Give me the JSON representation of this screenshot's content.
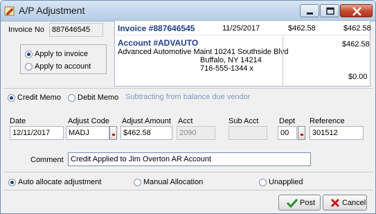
{
  "window": {
    "title": "A/P Adjustment"
  },
  "invoice_header": {
    "invoice_no_label": "Invoice No",
    "invoice_no_value": "887646545",
    "invoice_heading": "Invoice #887646545",
    "date": "11/25/2017",
    "amount_1": "$462.58",
    "amount_2": "$462.58"
  },
  "apply_options": {
    "apply_to_invoice": "Apply to invoice",
    "apply_to_account": "Apply to account",
    "selected": "apply_to_invoice"
  },
  "account": {
    "heading": "Account #ADVAUTO",
    "name_line": "Advanced Automotive Maint 10241 Southside Blvd",
    "city_line": "Buffalo, NY  14214",
    "phone_line": "716-555-1344 x"
  },
  "balance_panel": {
    "top_amount": "$462.58",
    "bottom_amount": "$0.00"
  },
  "memo_type": {
    "credit_memo": "Credit Memo",
    "debit_memo": "Debit Memo",
    "selected": "credit_memo",
    "hint": "Subtracting from balance due vendor"
  },
  "fields": {
    "date_label": "Date",
    "date_value": "12/11/2017",
    "adjust_code_label": "Adjust Code",
    "adjust_code_value": "MADJ",
    "adjust_amount_label": "Adjust Amount",
    "adjust_amount_value": "$462.58",
    "acct_label": "Acct",
    "acct_value": "2090",
    "sub_acct_label": "Sub Acct",
    "sub_acct_value": "",
    "dept_label": "Dept",
    "dept_value": "00",
    "reference_label": "Reference",
    "reference_value": "301512",
    "comment_label": "Comment",
    "comment_value": "Credit Applied to Jim Overton AR Account"
  },
  "allocation": {
    "auto": "Auto allocate adjustment",
    "manual": "Manual Allocation",
    "unapplied": "Unapplied",
    "selected": "auto"
  },
  "buttons": {
    "post": "Post",
    "cancel": "Cancel"
  },
  "colors": {
    "accent_blue": "#1f3f86",
    "hint_text": "#7d97c2",
    "cancel_red": "#c21d1d",
    "post_green": "#2e8b2e"
  }
}
